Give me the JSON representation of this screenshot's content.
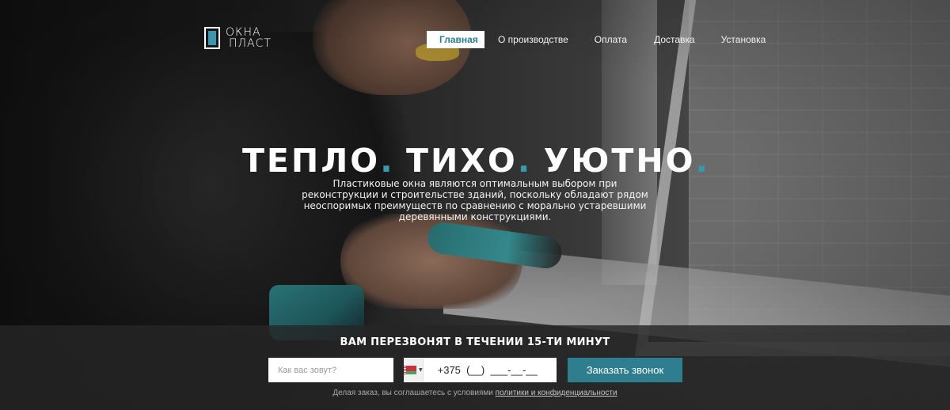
{
  "logo": {
    "line1": "ОКНА",
    "line2": "ПЛАСТ"
  },
  "nav": {
    "items": [
      {
        "label": "Главная",
        "active": true
      },
      {
        "label": "О производстве"
      },
      {
        "label": "Оплата"
      },
      {
        "label": "Доставка"
      },
      {
        "label": "Установка"
      }
    ]
  },
  "hero": {
    "headline_words": [
      "ТЕПЛО",
      "ТИХО",
      "УЮТНО"
    ],
    "headline_dot": ".",
    "subtitle": "Пластиковые окна являются оптимальным выбором при реконструкции и строительстве зданий, поскольку обладают рядом неоспоримых преимуществ по сравнению с морально устаревшими деревянными конструкциями."
  },
  "callback": {
    "title": "ВАМ ПЕРЕЗВОНЯТ В ТЕЧЕНИИ 15-ТИ МИНУТ",
    "name_placeholder": "Как вас зовут?",
    "phone_value": "+375  (__)  ___-__-__",
    "country_flag": "belarus-flag-icon",
    "submit_label": "Заказать звонок",
    "agree_prefix": "Делая заказ, вы соглашаетесь с условиями ",
    "agree_link": "политики и конфиденциальности"
  },
  "colors": {
    "accent": "#3a97ad",
    "button": "#2f7e8f",
    "nav_active_text": "#2a7d93"
  }
}
